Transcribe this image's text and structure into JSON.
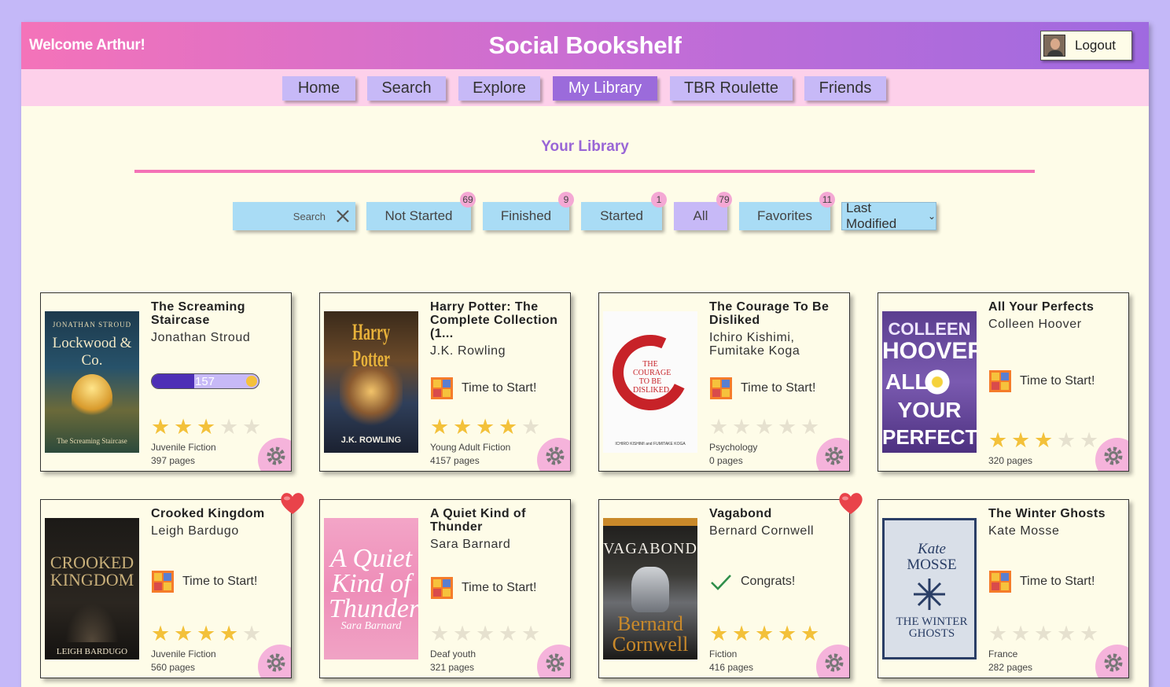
{
  "header": {
    "welcome": "Welcome Arthur!",
    "brand": "Social Bookshelf",
    "logout_label": "Logout"
  },
  "nav": {
    "items": [
      "Home",
      "Search",
      "Explore",
      "My Library",
      "TBR Roulette",
      "Friends"
    ],
    "active": "My Library"
  },
  "library": {
    "title": "Your Library",
    "search_placeholder": "Search",
    "filters": [
      {
        "label": "Not Started",
        "count": "69"
      },
      {
        "label": "Finished",
        "count": "9"
      },
      {
        "label": "Started",
        "count": "1"
      },
      {
        "label": "All",
        "count": "79"
      },
      {
        "label": "Favorites",
        "count": "11"
      }
    ],
    "sort": "Last Modified"
  },
  "colors": {
    "star_on": "#f3c13a",
    "star_off": "#e6e1cf",
    "accent": "#9b6bdb",
    "pink": "#f472b6"
  },
  "books": [
    {
      "title": "The Screaming Staircase",
      "author": "Jonathan Stroud",
      "status": "progress",
      "progress_page": "157",
      "progress_fraction": 0.4,
      "rating": 3,
      "genre": "Juvenile Fiction",
      "pages": "397 pages",
      "favorite": false,
      "cover_texts": [
        "JONATHAN STROUD",
        "Lockwood & Co.",
        "The Screaming Staircase"
      ]
    },
    {
      "title": "Harry Potter: The Complete Collection (1...",
      "author": "J.K. Rowling",
      "status": "tbr",
      "status_text": "Time to Start!",
      "rating": 4,
      "genre": "Young Adult Fiction",
      "pages": "4157 pages",
      "favorite": false,
      "cover_texts": [
        "Harry Potter",
        "J.K. ROWLING"
      ]
    },
    {
      "title": "The Courage To Be Disliked",
      "author": "Ichiro Kishimi, Fumitake Koga",
      "status": "tbr",
      "status_text": "Time to Start!",
      "rating": 0,
      "genre": "Psychology",
      "pages": "0 pages",
      "favorite": false,
      "cover_texts": [
        "THE COURAGE TO BE DISLIKED",
        "ICHIRO KISHIMI and FUMITAKE KOGA"
      ]
    },
    {
      "title": "All Your Perfects",
      "author": "Colleen Hoover",
      "status": "tbr",
      "status_text": "Time to Start!",
      "rating": 3,
      "genre": "",
      "pages": "320 pages",
      "favorite": false,
      "cover_texts": [
        "COLLEEN",
        "HOOVER",
        "ALL",
        "YOUR",
        "PERFECTS"
      ]
    },
    {
      "title": "Crooked Kingdom",
      "author": "Leigh Bardugo",
      "status": "tbr",
      "status_text": "Time to Start!",
      "rating": 4,
      "genre": "Juvenile Fiction",
      "pages": "560 pages",
      "favorite": true,
      "cover_texts": [
        "CROOKED",
        "KINGDOM",
        "LEIGH BARDUGO"
      ]
    },
    {
      "title": "A Quiet Kind of Thunder",
      "author": "Sara Barnard",
      "status": "tbr",
      "status_text": "Time to Start!",
      "rating": 0,
      "genre": "Deaf youth",
      "pages": "321 pages",
      "favorite": false,
      "cover_texts": [
        "A Quiet Kind of Thunder",
        "Sara Barnard"
      ]
    },
    {
      "title": "Vagabond",
      "author": "Bernard Cornwell",
      "status": "done",
      "status_text": "Congrats!",
      "rating": 5,
      "genre": "Fiction",
      "pages": "416 pages",
      "favorite": true,
      "cover_texts": [
        "VAGABOND",
        "Bernard",
        "Cornwell"
      ]
    },
    {
      "title": "The Winter Ghosts",
      "author": "Kate Mosse",
      "status": "tbr",
      "status_text": "Time to Start!",
      "rating": 0,
      "genre": "France",
      "pages": "282 pages",
      "favorite": false,
      "cover_texts": [
        "Kate",
        "MOSSE",
        "THE WINTER GHOSTS"
      ]
    }
  ]
}
